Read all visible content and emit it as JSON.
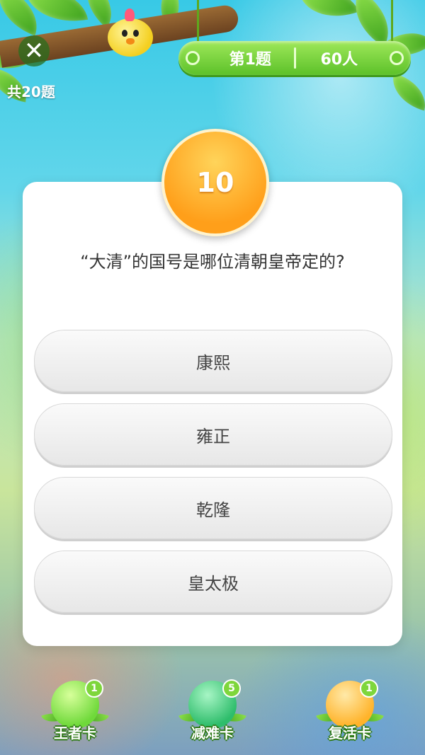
{
  "header": {
    "close_icon": "close-icon",
    "total_label": "共20题",
    "question_number": "第1题",
    "players": "60人"
  },
  "timer": {
    "value": "10"
  },
  "question": {
    "text": "“大清”的国号是哪位清朝皇帝定的?",
    "options": [
      "康熙",
      "雍正",
      "乾隆",
      "皇太极"
    ]
  },
  "powerups": [
    {
      "label": "王者卡",
      "count": "1",
      "icon": "chick-icon",
      "color": "#6fd93a"
    },
    {
      "label": "减难卡",
      "count": "5",
      "icon": "hammer-icon",
      "color": "#2ebd6b"
    },
    {
      "label": "复活卡",
      "count": "1",
      "icon": "egg-icon",
      "color": "#ffb32a"
    }
  ]
}
